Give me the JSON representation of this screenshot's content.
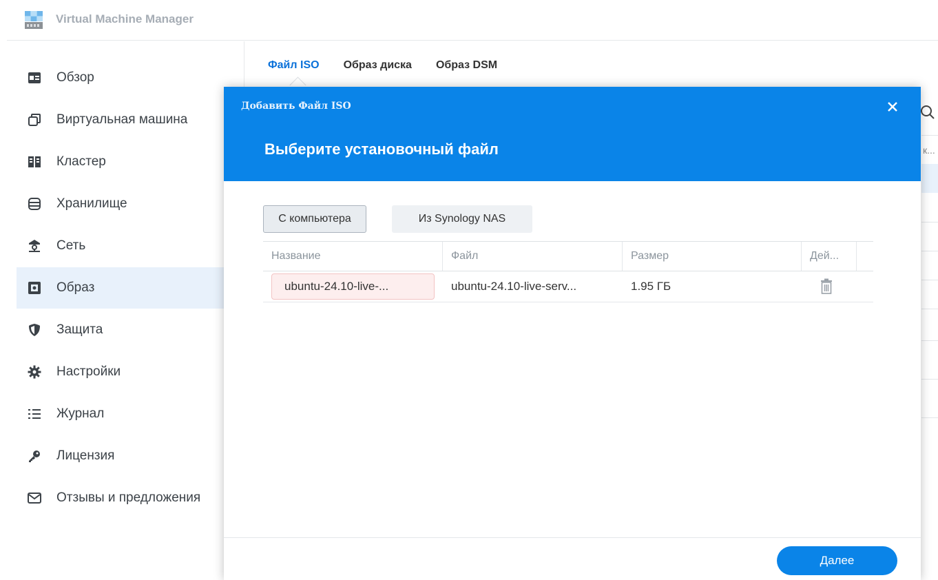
{
  "app": {
    "name": "Virtual Machine Manager",
    "logo_icon": "vmm-logo-icon"
  },
  "sidebar": {
    "active_index": 5,
    "items": [
      {
        "label": "Обзор",
        "icon": "overview-icon"
      },
      {
        "label": "Виртуальная машина",
        "icon": "virtual-machine-icon"
      },
      {
        "label": "Кластер",
        "icon": "cluster-icon"
      },
      {
        "label": "Хранилище",
        "icon": "storage-icon"
      },
      {
        "label": "Сеть",
        "icon": "network-icon"
      },
      {
        "label": "Образ",
        "icon": "image-icon"
      },
      {
        "label": "Защита",
        "icon": "shield-icon"
      },
      {
        "label": "Настройки",
        "icon": "gear-icon"
      },
      {
        "label": "Журнал",
        "icon": "log-list-icon"
      },
      {
        "label": "Лицензия",
        "icon": "key-icon"
      },
      {
        "label": "Отзывы и предложения",
        "icon": "mail-icon"
      }
    ]
  },
  "content": {
    "tabs": [
      {
        "label": "Файл ISO",
        "active": true
      },
      {
        "label": "Образ диска",
        "active": false
      },
      {
        "label": "Образ DSM",
        "active": false
      }
    ],
    "partial_text": "к..."
  },
  "modal": {
    "title": "Добавить Файл ISO",
    "heading": "Выберите установочный файл",
    "source_buttons": {
      "computer": "С компьютера",
      "nas": "Из Synology NAS"
    },
    "columns": {
      "name": "Название",
      "file": "Файл",
      "size": "Размер",
      "action": "Дей..."
    },
    "rows": [
      {
        "name": "ubuntu-24.10-live-...",
        "file": "ubuntu-24.10-live-serv...",
        "size": "1.95 ГБ",
        "action_icon": "trash-icon"
      }
    ],
    "next_label": "Далее"
  },
  "colors": {
    "accent": "#0a84e8",
    "active_nav_bg": "#e8f1fb",
    "tab_active": "#0a71d9",
    "error_cell_bg": "#fdeeee"
  }
}
